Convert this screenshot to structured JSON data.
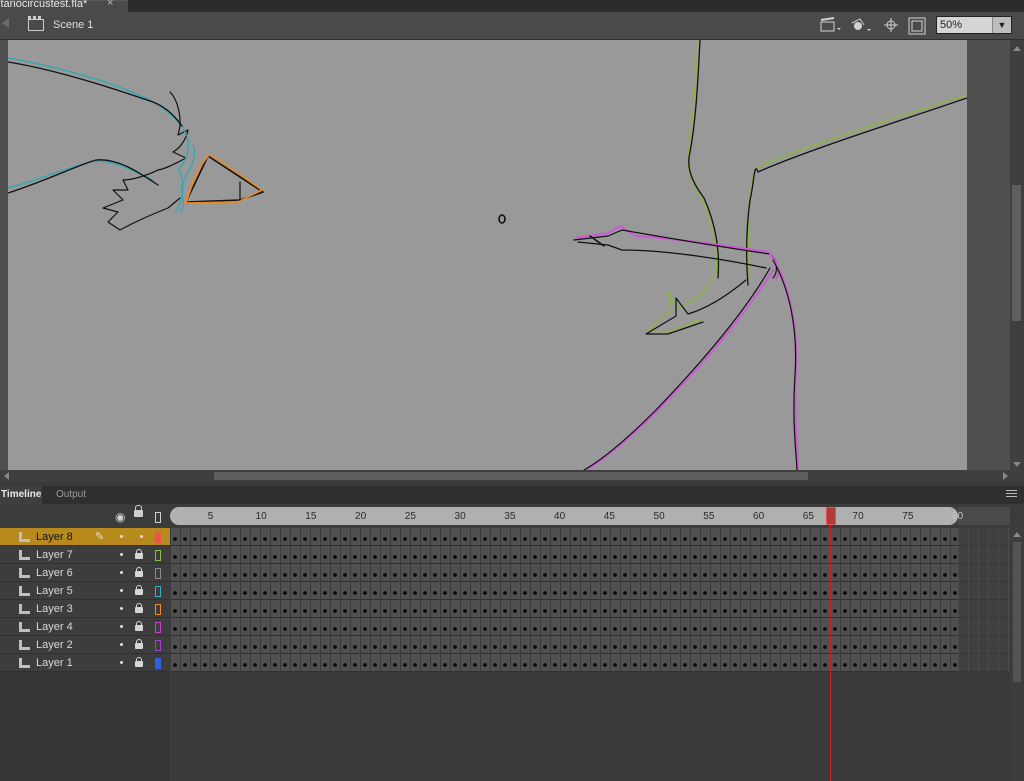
{
  "document": {
    "tab_title": "itanocircustest.fla*",
    "close_glyph": "×"
  },
  "edit_bar": {
    "scene_label": "Scene 1",
    "zoom_value": "50%",
    "icons": [
      "back-arrow-icon",
      "scene-icon",
      "edit-scene-icon",
      "edit-symbol-icon",
      "center-stage-icon",
      "clip-stage-icon",
      "zoom-dropdown-icon"
    ]
  },
  "panel_tabs": {
    "timeline": "Timeline",
    "output": "Output"
  },
  "timeline": {
    "ruler_ticks": [
      "5",
      "10",
      "15",
      "20",
      "25",
      "30",
      "35",
      "40",
      "45",
      "50",
      "55",
      "60",
      "65",
      "70",
      "75",
      "80"
    ],
    "current_frame": 67,
    "layers": [
      {
        "name": "Layer 8",
        "selected": true,
        "color": "#e8564a"
      },
      {
        "name": "Layer 7",
        "selected": false,
        "color": "#8cbf3f"
      },
      {
        "name": "Layer 6",
        "selected": false,
        "color": "#8a8a8a"
      },
      {
        "name": "Layer 5",
        "selected": false,
        "color": "#30b0c0"
      },
      {
        "name": "Layer 3",
        "selected": false,
        "color": "#f08a28"
      },
      {
        "name": "Layer 4",
        "selected": false,
        "color": "#d040d0"
      },
      {
        "name": "Layer 2",
        "selected": false,
        "color": "#a040d0"
      },
      {
        "name": "Layer 1",
        "selected": false,
        "color": "#3060e0"
      }
    ]
  },
  "colors": {
    "stage": "#999999",
    "selection": "#b88a1e",
    "playhead": "#cc2222"
  }
}
